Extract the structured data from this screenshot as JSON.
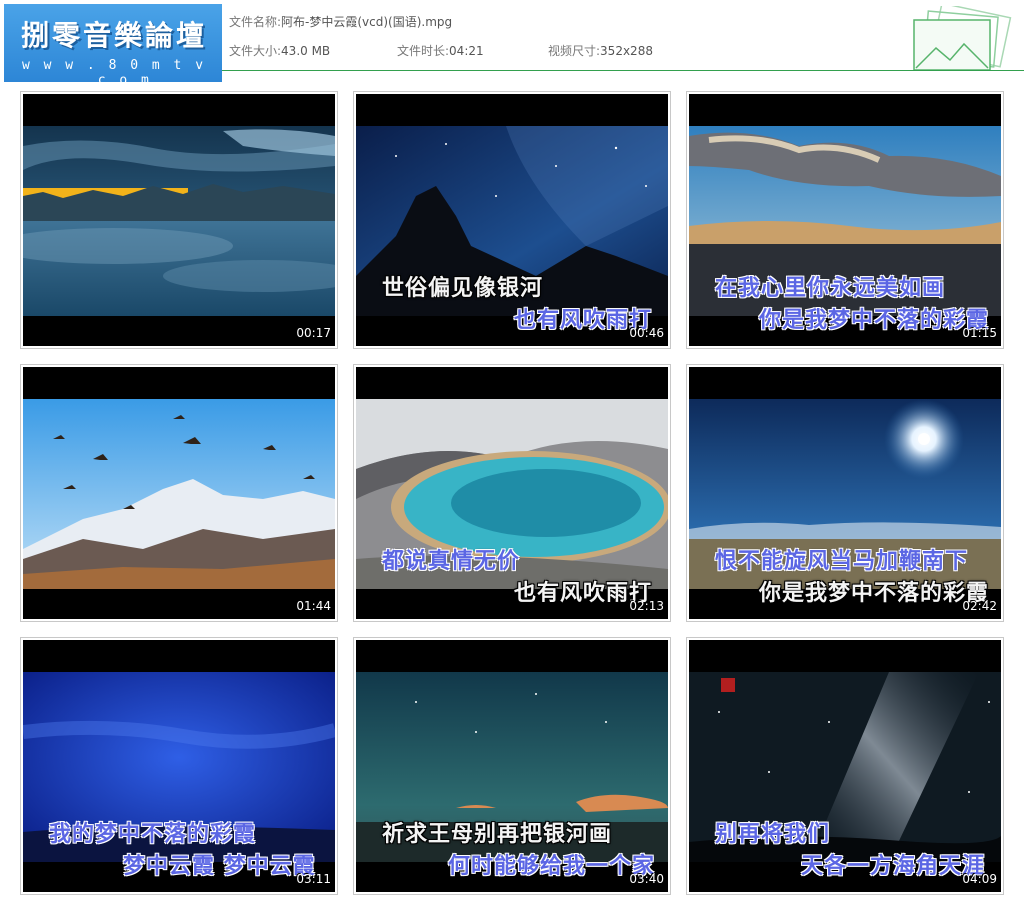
{
  "header": {
    "logo_title": "捌零音樂論壇",
    "logo_url": "w w w . 8 0 m t v . c o m",
    "file_name_label": "文件名称:",
    "file_name": "阿布-梦中云霞(vcd)(国语).mpg",
    "file_size_label": "文件大小:",
    "file_size": "43.0 MB",
    "duration_label": "文件时长:",
    "duration": "04:21",
    "dimensions_label": "视频尺寸:",
    "dimensions": "352x288",
    "accent_color": "#33a04e"
  },
  "thumbnails": [
    {
      "timestamp": "00:17",
      "lyric1": "",
      "lyric2": "",
      "scene": "clouds-sunset-sea-of-clouds"
    },
    {
      "timestamp": "00:46",
      "lyric1": "世俗偏见像银河",
      "lyric2": "也有风吹雨打",
      "scene": "starry-sky-mountain-silhouette"
    },
    {
      "timestamp": "01:15",
      "lyric1": "在我心里你永远美如画",
      "lyric2": "你是我梦中不落的彩霞",
      "scene": "clouds-over-plateau"
    },
    {
      "timestamp": "01:44",
      "lyric1": "",
      "lyric2": "",
      "scene": "birds-snow-mountain"
    },
    {
      "timestamp": "02:13",
      "lyric1": "都说真情无价",
      "lyric2": "也有风吹雨打",
      "scene": "turquoise-lake-snow"
    },
    {
      "timestamp": "02:42",
      "lyric1": "恨不能旋风当马加鞭南下",
      "lyric2": "你是我梦中不落的彩霞",
      "scene": "sun-blue-sky-plain"
    },
    {
      "timestamp": "03:11",
      "lyric1": "我的梦中不落的彩霞",
      "lyric2": "梦中云霞 梦中云霞",
      "scene": "deep-blue-sky"
    },
    {
      "timestamp": "03:40",
      "lyric1": "祈求王母别再把银河画",
      "lyric2": "何时能够给我一个家",
      "scene": "teal-dusk-sky"
    },
    {
      "timestamp": "04:09",
      "lyric1": "别再将我们",
      "lyric2": "天各一方海角天涯",
      "scene": "milky-way-night"
    }
  ]
}
